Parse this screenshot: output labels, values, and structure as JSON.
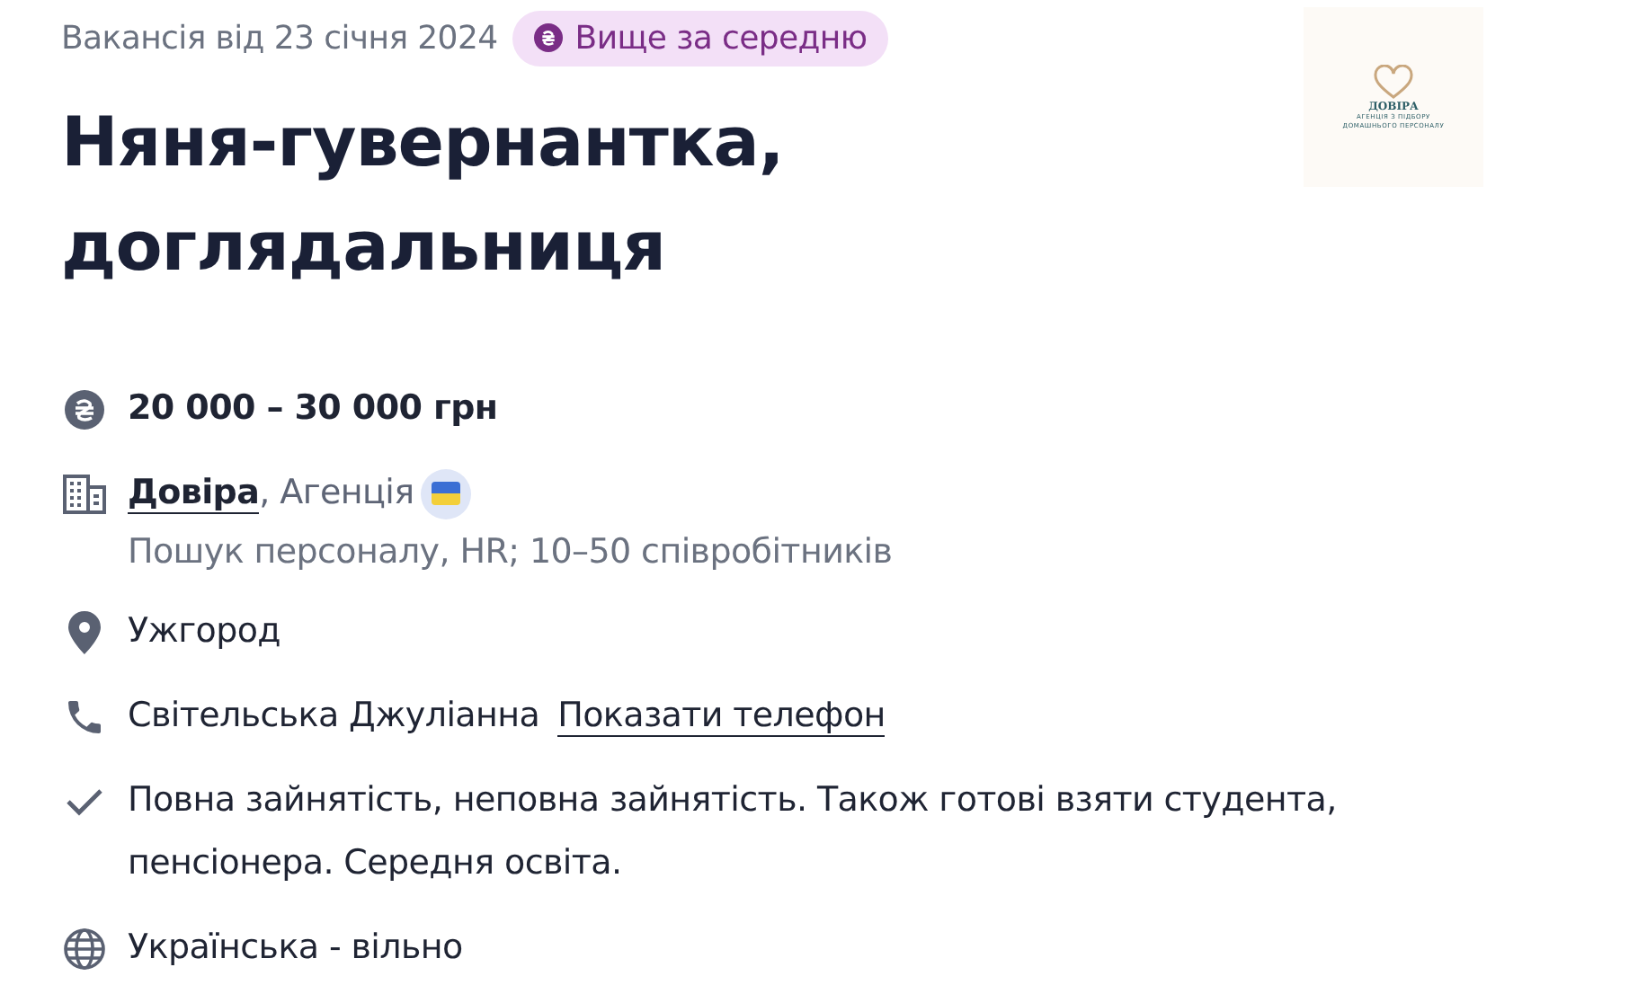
{
  "posted": "Вакансія від 23 січня 2024",
  "badge": {
    "label": "Вище за середню"
  },
  "title": "Няня-гувернантка, доглядальниця",
  "logo": {
    "name": "ДОВІРА",
    "tagline": [
      "АГЕНЦІЯ З ПІДБОРУ",
      "ДОМАШНЬОГО ПЕРСОНАЛУ"
    ]
  },
  "details": [
    {
      "kind": "salary",
      "text": "20 000 – 30 000 грн"
    },
    {
      "kind": "company",
      "link": "Довіра",
      "text": ", Агенція",
      "note": "Пошук персоналу, HR; 10–50 співробітників"
    },
    {
      "kind": "location",
      "text": "Ужгород"
    },
    {
      "kind": "contact",
      "text": "Світельська Джуліанна",
      "link": "Показати телефон"
    },
    {
      "kind": "employment",
      "text": "Повна зайнятість, неповна зайнятість. Також готові взяти студента, пенсіонера. Середня освіта."
    },
    {
      "kind": "language",
      "text": "Українська - вільно"
    }
  ]
}
